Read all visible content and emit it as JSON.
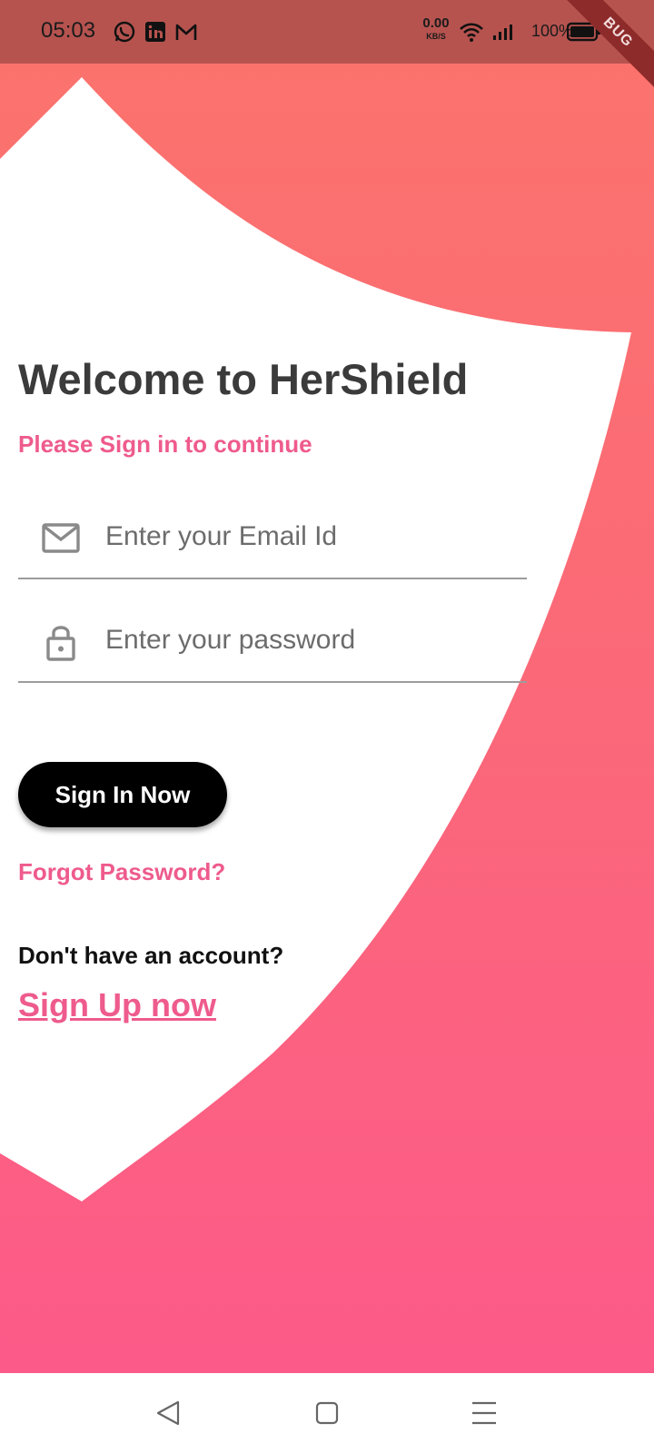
{
  "status_bar": {
    "time": "05:03",
    "net_speed_value": "0.00",
    "net_speed_unit": "KB/S",
    "battery_percent": "100%",
    "debug_banner": "BUG",
    "icons": [
      "whatsapp-icon",
      "linkedin-icon",
      "gmail-icon",
      "wifi-icon",
      "signal-icon",
      "battery-icon"
    ]
  },
  "login": {
    "title": "Welcome to HerShield",
    "subtitle": "Please Sign in to continue",
    "email_placeholder": "Enter your Email Id",
    "password_placeholder": "Enter your password",
    "signin_label": "Sign In Now",
    "forgot_label": "Forgot Password?",
    "no_account_label": "Don't have an account?",
    "signup_label": "Sign Up now"
  },
  "colors": {
    "accent_pink": "#ee5b8c",
    "gradient_top": "#fb736c",
    "gradient_bottom": "#fc5a89",
    "status_bar": "#b6534f",
    "button": "#000000"
  },
  "nav_bar": {
    "icons": [
      "back-icon",
      "home-icon",
      "menu-icon"
    ]
  }
}
